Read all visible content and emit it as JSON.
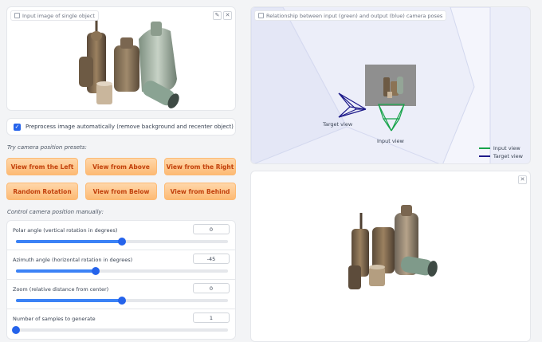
{
  "input_panel": {
    "tag_label": "Input image of single object"
  },
  "preprocess": {
    "label": "Preprocess image automatically (remove background and recenter object)",
    "checked": true
  },
  "presets": {
    "label": "Try camera position presets:",
    "buttons": [
      "View from the Left",
      "View from Above",
      "View from the Right",
      "Random Rotation",
      "View from Below",
      "View from Behind"
    ]
  },
  "manual": {
    "label": "Control camera position manually:"
  },
  "sliders": [
    {
      "label": "Polar angle (vertical rotation in degrees)",
      "value": "0",
      "fraction": 0.5
    },
    {
      "label": "Azimuth angle (horizontal rotation in degrees)",
      "value": "-45",
      "fraction": 0.375
    },
    {
      "label": "Zoom (relative distance from center)",
      "value": "0",
      "fraction": 0.5
    },
    {
      "label": "Number of samples to generate",
      "value": "1",
      "fraction": 0.0
    }
  ],
  "pose_panel": {
    "tag_label": "Relationship between input (green) and output (blue) camera poses",
    "target_label": "Target view",
    "input_label": "Input view",
    "legend": [
      {
        "label": "Input view",
        "color": "#16a34a"
      },
      {
        "label": "Target view",
        "color": "#1e1b8a"
      }
    ]
  },
  "colors": {
    "accent": "#2563eb",
    "preset_text": "#c2410c",
    "preset_bg": "#fdba74"
  }
}
